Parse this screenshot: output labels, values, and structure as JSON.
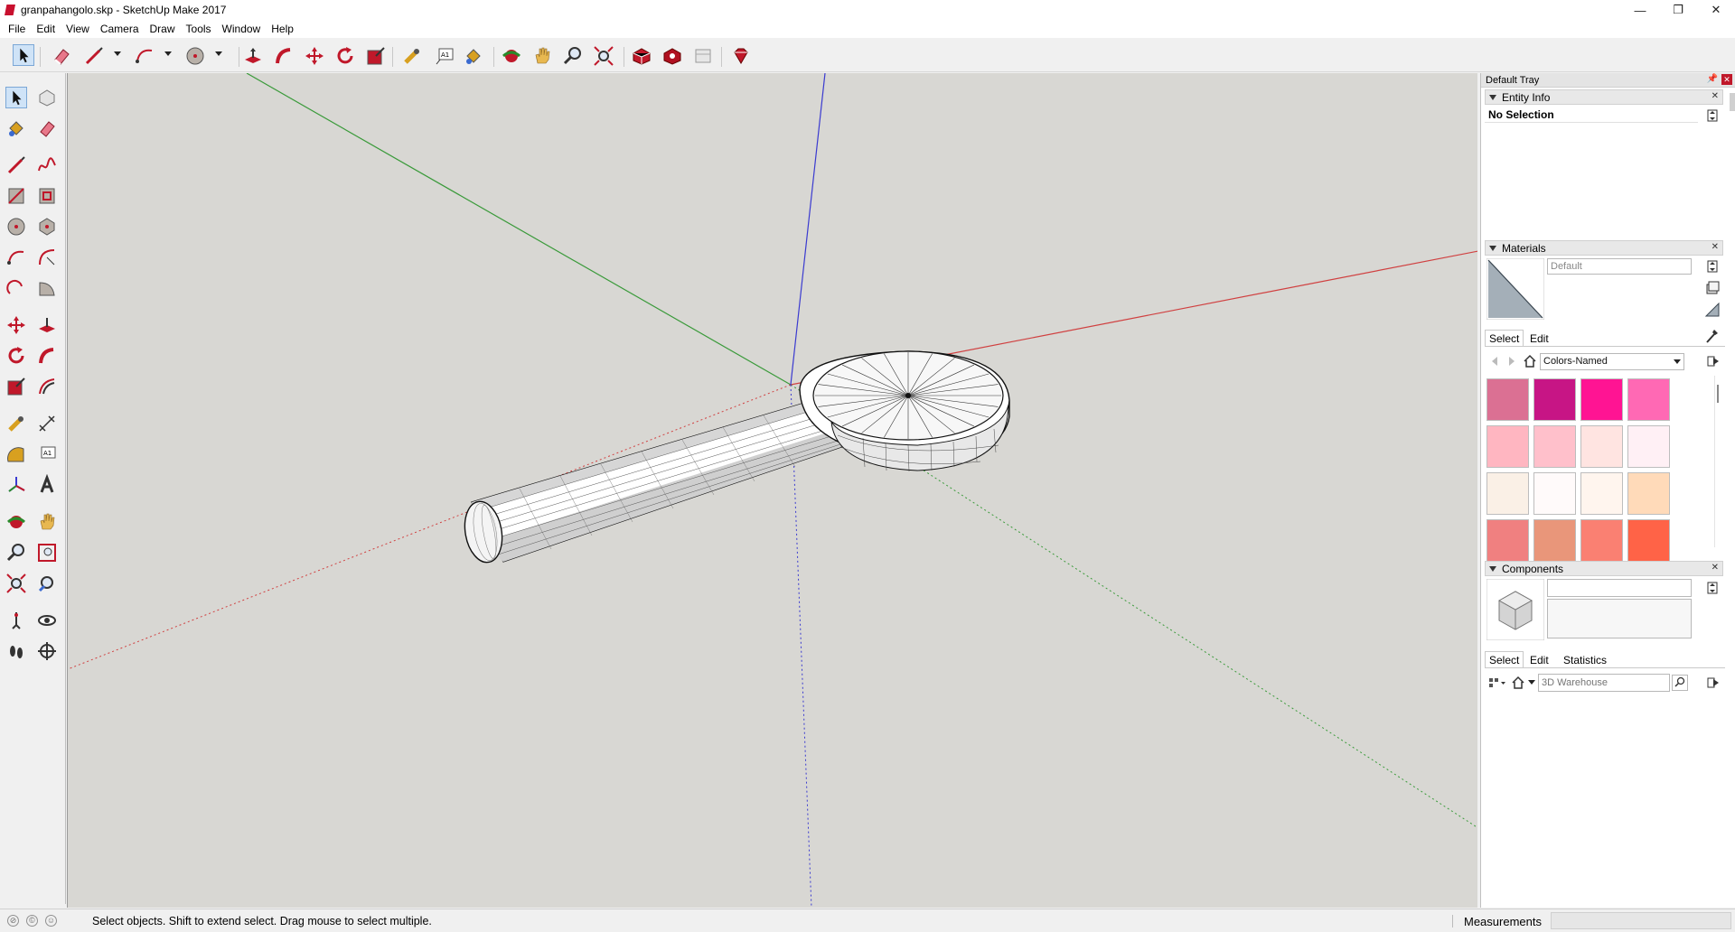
{
  "window": {
    "title": "granpahangolo.skp - SketchUp Make 2017",
    "minimize": "—",
    "maximize": "❐",
    "close": "✕"
  },
  "menu": [
    "File",
    "Edit",
    "View",
    "Camera",
    "Draw",
    "Tools",
    "Window",
    "Help"
  ],
  "toolbar": {
    "icons": [
      "select-icon",
      "eraser-icon",
      "line-icon",
      "arc-icon",
      "circle-icon",
      "push-pull-icon",
      "follow-me-icon",
      "move-icon",
      "rotate-icon",
      "scale-icon",
      "tape-measure-icon",
      "text-icon",
      "paint-bucket-icon",
      "orbit-icon",
      "pan-icon",
      "zoom-icon",
      "zoom-extents-icon",
      "3d-warehouse-icon",
      "extension-warehouse-icon",
      "layout-icon",
      "ruby-icon"
    ]
  },
  "tray": {
    "title": "Default Tray",
    "entity_info": {
      "title": "Entity Info",
      "selection": "No Selection"
    },
    "materials": {
      "title": "Materials",
      "material_name": "Default",
      "tab_select": "Select",
      "tab_edit": "Edit",
      "library": "Colors-Named",
      "swatches": [
        "#db7093",
        "#c71585",
        "#ff1493",
        "#ff69b4",
        "#ffb6c1",
        "#ffc0cb",
        "#ffe4e1",
        "#fff0f5",
        "#faf0e6",
        "#fffafa",
        "#fff5ee",
        "#ffdab9",
        "#f08080",
        "#e9967a",
        "#fa8072",
        "#ff6347"
      ]
    },
    "components": {
      "title": "Components",
      "tab_select": "Select",
      "tab_edit": "Edit",
      "tab_statistics": "Statistics",
      "search_placeholder": "3D Warehouse"
    }
  },
  "status": {
    "hint": "Select objects. Shift to extend select. Drag mouse to select multiple.",
    "measurements_label": "Measurements",
    "measurements_value": ""
  },
  "colors": {
    "viewport_bg": "#d8d7d3",
    "axis_red": "#d04040",
    "axis_green": "#3a9a3a",
    "axis_blue": "#3a3ad0"
  }
}
